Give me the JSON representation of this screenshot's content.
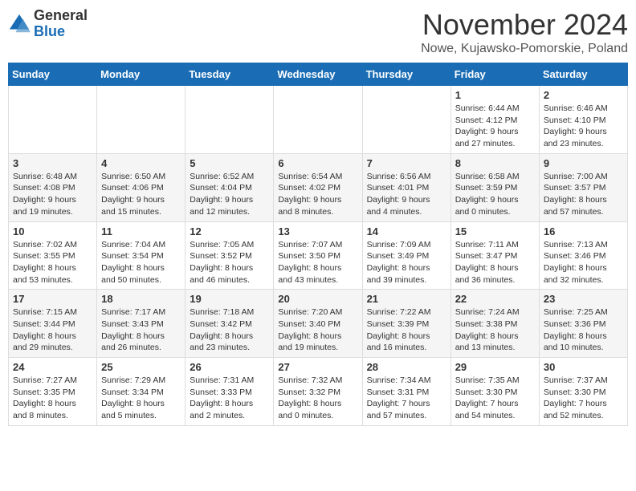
{
  "logo": {
    "general": "General",
    "blue": "Blue"
  },
  "title": "November 2024",
  "location": "Nowe, Kujawsko-Pomorskie, Poland",
  "days_of_week": [
    "Sunday",
    "Monday",
    "Tuesday",
    "Wednesday",
    "Thursday",
    "Friday",
    "Saturday"
  ],
  "weeks": [
    [
      {
        "day": "",
        "info": ""
      },
      {
        "day": "",
        "info": ""
      },
      {
        "day": "",
        "info": ""
      },
      {
        "day": "",
        "info": ""
      },
      {
        "day": "",
        "info": ""
      },
      {
        "day": "1",
        "info": "Sunrise: 6:44 AM\nSunset: 4:12 PM\nDaylight: 9 hours and 27 minutes."
      },
      {
        "day": "2",
        "info": "Sunrise: 6:46 AM\nSunset: 4:10 PM\nDaylight: 9 hours and 23 minutes."
      }
    ],
    [
      {
        "day": "3",
        "info": "Sunrise: 6:48 AM\nSunset: 4:08 PM\nDaylight: 9 hours and 19 minutes."
      },
      {
        "day": "4",
        "info": "Sunrise: 6:50 AM\nSunset: 4:06 PM\nDaylight: 9 hours and 15 minutes."
      },
      {
        "day": "5",
        "info": "Sunrise: 6:52 AM\nSunset: 4:04 PM\nDaylight: 9 hours and 12 minutes."
      },
      {
        "day": "6",
        "info": "Sunrise: 6:54 AM\nSunset: 4:02 PM\nDaylight: 9 hours and 8 minutes."
      },
      {
        "day": "7",
        "info": "Sunrise: 6:56 AM\nSunset: 4:01 PM\nDaylight: 9 hours and 4 minutes."
      },
      {
        "day": "8",
        "info": "Sunrise: 6:58 AM\nSunset: 3:59 PM\nDaylight: 9 hours and 0 minutes."
      },
      {
        "day": "9",
        "info": "Sunrise: 7:00 AM\nSunset: 3:57 PM\nDaylight: 8 hours and 57 minutes."
      }
    ],
    [
      {
        "day": "10",
        "info": "Sunrise: 7:02 AM\nSunset: 3:55 PM\nDaylight: 8 hours and 53 minutes."
      },
      {
        "day": "11",
        "info": "Sunrise: 7:04 AM\nSunset: 3:54 PM\nDaylight: 8 hours and 50 minutes."
      },
      {
        "day": "12",
        "info": "Sunrise: 7:05 AM\nSunset: 3:52 PM\nDaylight: 8 hours and 46 minutes."
      },
      {
        "day": "13",
        "info": "Sunrise: 7:07 AM\nSunset: 3:50 PM\nDaylight: 8 hours and 43 minutes."
      },
      {
        "day": "14",
        "info": "Sunrise: 7:09 AM\nSunset: 3:49 PM\nDaylight: 8 hours and 39 minutes."
      },
      {
        "day": "15",
        "info": "Sunrise: 7:11 AM\nSunset: 3:47 PM\nDaylight: 8 hours and 36 minutes."
      },
      {
        "day": "16",
        "info": "Sunrise: 7:13 AM\nSunset: 3:46 PM\nDaylight: 8 hours and 32 minutes."
      }
    ],
    [
      {
        "day": "17",
        "info": "Sunrise: 7:15 AM\nSunset: 3:44 PM\nDaylight: 8 hours and 29 minutes."
      },
      {
        "day": "18",
        "info": "Sunrise: 7:17 AM\nSunset: 3:43 PM\nDaylight: 8 hours and 26 minutes."
      },
      {
        "day": "19",
        "info": "Sunrise: 7:18 AM\nSunset: 3:42 PM\nDaylight: 8 hours and 23 minutes."
      },
      {
        "day": "20",
        "info": "Sunrise: 7:20 AM\nSunset: 3:40 PM\nDaylight: 8 hours and 19 minutes."
      },
      {
        "day": "21",
        "info": "Sunrise: 7:22 AM\nSunset: 3:39 PM\nDaylight: 8 hours and 16 minutes."
      },
      {
        "day": "22",
        "info": "Sunrise: 7:24 AM\nSunset: 3:38 PM\nDaylight: 8 hours and 13 minutes."
      },
      {
        "day": "23",
        "info": "Sunrise: 7:25 AM\nSunset: 3:36 PM\nDaylight: 8 hours and 10 minutes."
      }
    ],
    [
      {
        "day": "24",
        "info": "Sunrise: 7:27 AM\nSunset: 3:35 PM\nDaylight: 8 hours and 8 minutes."
      },
      {
        "day": "25",
        "info": "Sunrise: 7:29 AM\nSunset: 3:34 PM\nDaylight: 8 hours and 5 minutes."
      },
      {
        "day": "26",
        "info": "Sunrise: 7:31 AM\nSunset: 3:33 PM\nDaylight: 8 hours and 2 minutes."
      },
      {
        "day": "27",
        "info": "Sunrise: 7:32 AM\nSunset: 3:32 PM\nDaylight: 8 hours and 0 minutes."
      },
      {
        "day": "28",
        "info": "Sunrise: 7:34 AM\nSunset: 3:31 PM\nDaylight: 7 hours and 57 minutes."
      },
      {
        "day": "29",
        "info": "Sunrise: 7:35 AM\nSunset: 3:30 PM\nDaylight: 7 hours and 54 minutes."
      },
      {
        "day": "30",
        "info": "Sunrise: 7:37 AM\nSunset: 3:30 PM\nDaylight: 7 hours and 52 minutes."
      }
    ]
  ]
}
